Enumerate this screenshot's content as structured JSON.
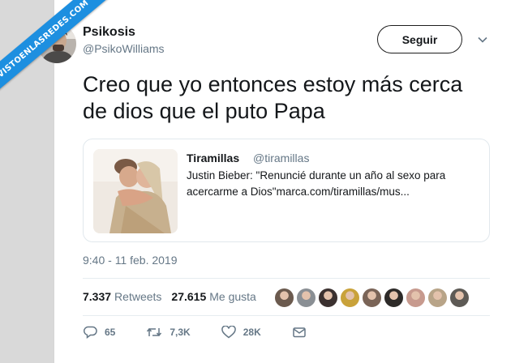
{
  "watermark": {
    "text": "VISTOENLASREDES.COM"
  },
  "tweet": {
    "author_name": "Psikosis",
    "author_handle": "@PsikoWilliams",
    "follow_label": "Seguir",
    "text_line1": "Creo que yo entonces estoy más cerca",
    "text_line2": "de dios que el puto Papa",
    "timestamp": "9:40 - 11 feb. 2019"
  },
  "quoted": {
    "name": "Tiramillas",
    "handle": "@tiramillas",
    "text_line1": "Justin Bieber: \"Renuncié durante un año al sexo para",
    "text_line2": "acercarme a Dios\"marca.com/tiramillas/mus..."
  },
  "stats": {
    "retweets_count": "7.337",
    "retweets_label": "Retweets",
    "likes_count": "27.615",
    "likes_label": "Me gusta"
  },
  "actions": {
    "replies": "65",
    "retweets": "7,3K",
    "likes": "28K"
  },
  "likers": [
    "#6b5a4e",
    "#8a8f94",
    "#3b3130",
    "#c9a23a",
    "#7a6457",
    "#2d2a28",
    "#c79a8e",
    "#b8a488",
    "#5d5a55"
  ],
  "icons": [
    "chevron-down-icon",
    "reply-icon",
    "retweet-icon",
    "heart-icon",
    "message-icon"
  ],
  "colors": {
    "accent": "#1d8fe0",
    "muted": "#657786",
    "text": "#14171a"
  }
}
